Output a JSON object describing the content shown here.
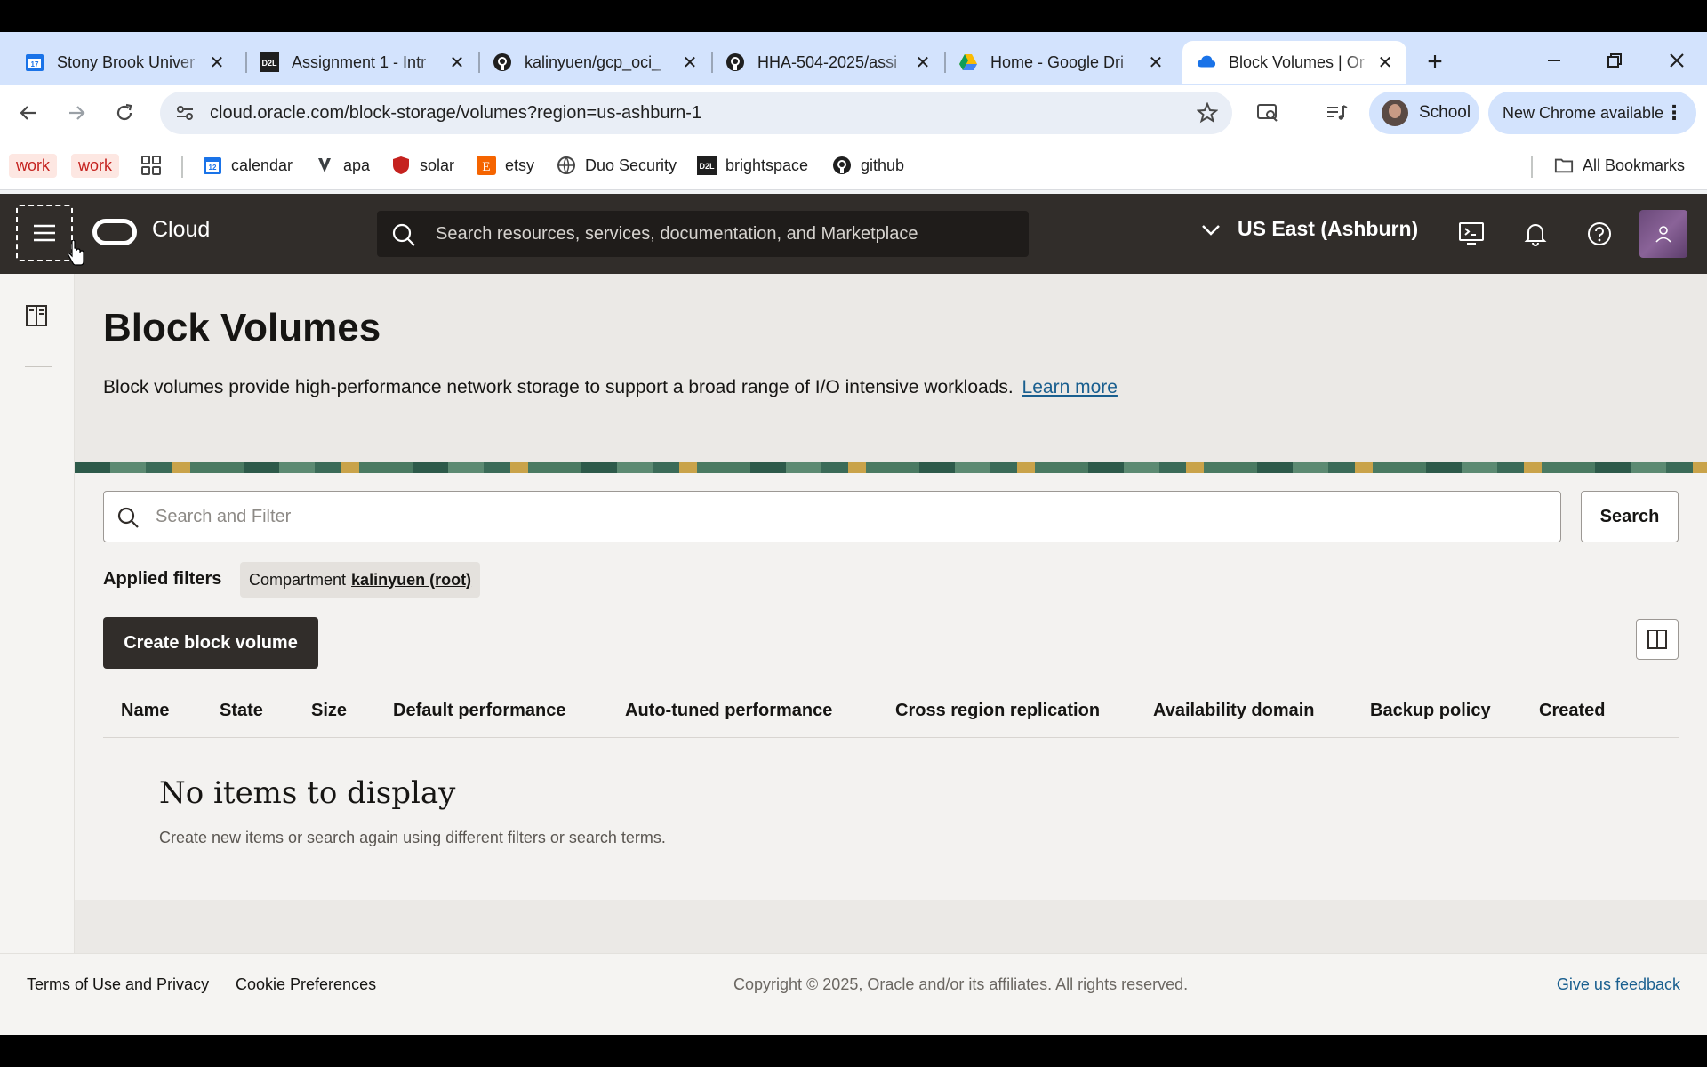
{
  "browser": {
    "tabs": [
      {
        "title": "Stony Brook Univer",
        "icon": "calendar-favicon"
      },
      {
        "title": "Assignment 1 - Intr",
        "icon": "d2l-favicon"
      },
      {
        "title": "kalinyuen/gcp_oci_",
        "icon": "github-favicon"
      },
      {
        "title": "HHA-504-2025/assi",
        "icon": "github-favicon"
      },
      {
        "title": "Home - Google Dri",
        "icon": "google-drive-favicon"
      },
      {
        "title": "Block Volumes | Or",
        "icon": "oracle-cloud-favicon",
        "active": true
      }
    ],
    "url": "cloud.oracle.com/block-storage/volumes?region=us-ashburn-1",
    "profile_label": "School",
    "update_label": "New Chrome available",
    "bookmarks": {
      "work1": "work",
      "work2": "work",
      "calendar": "calendar",
      "apa": "apa",
      "solar": "solar",
      "etsy": "etsy",
      "duo": "Duo Security",
      "brightspace": "brightspace",
      "github": "github",
      "all": "All Bookmarks"
    }
  },
  "oci": {
    "brand": "Cloud",
    "search_placeholder": "Search resources, services, documentation, and Marketplace",
    "region": "US East (Ashburn)",
    "page_title": "Block Volumes",
    "description": "Block volumes provide high-performance network storage to support a broad range of I/O intensive workloads.",
    "learn_more": "Learn more",
    "filter_placeholder": "Search and Filter",
    "search_button": "Search",
    "applied_filters_label": "Applied filters",
    "filter_chip_key": "Compartment",
    "filter_chip_value": "kalinyuen (root)",
    "create_button": "Create block volume",
    "columns": {
      "name": "Name",
      "state": "State",
      "size": "Size",
      "default_perf": "Default performance",
      "auto_perf": "Auto-tuned performance",
      "cross_region": "Cross region replication",
      "ad": "Availability domain",
      "backup": "Backup policy",
      "created": "Created"
    },
    "empty_title": "No items to display",
    "empty_desc": "Create new items or search again using different filters or search terms.",
    "footer": {
      "terms": "Terms of Use and Privacy",
      "cookies": "Cookie Preferences",
      "copyright": "Copyright © 2025, Oracle and/or its affiliates. All rights reserved.",
      "feedback": "Give us feedback"
    },
    "colors": {
      "header": "#312d2a",
      "link": "#1a5f8f",
      "tabstrip": "#d3e3fd"
    }
  }
}
